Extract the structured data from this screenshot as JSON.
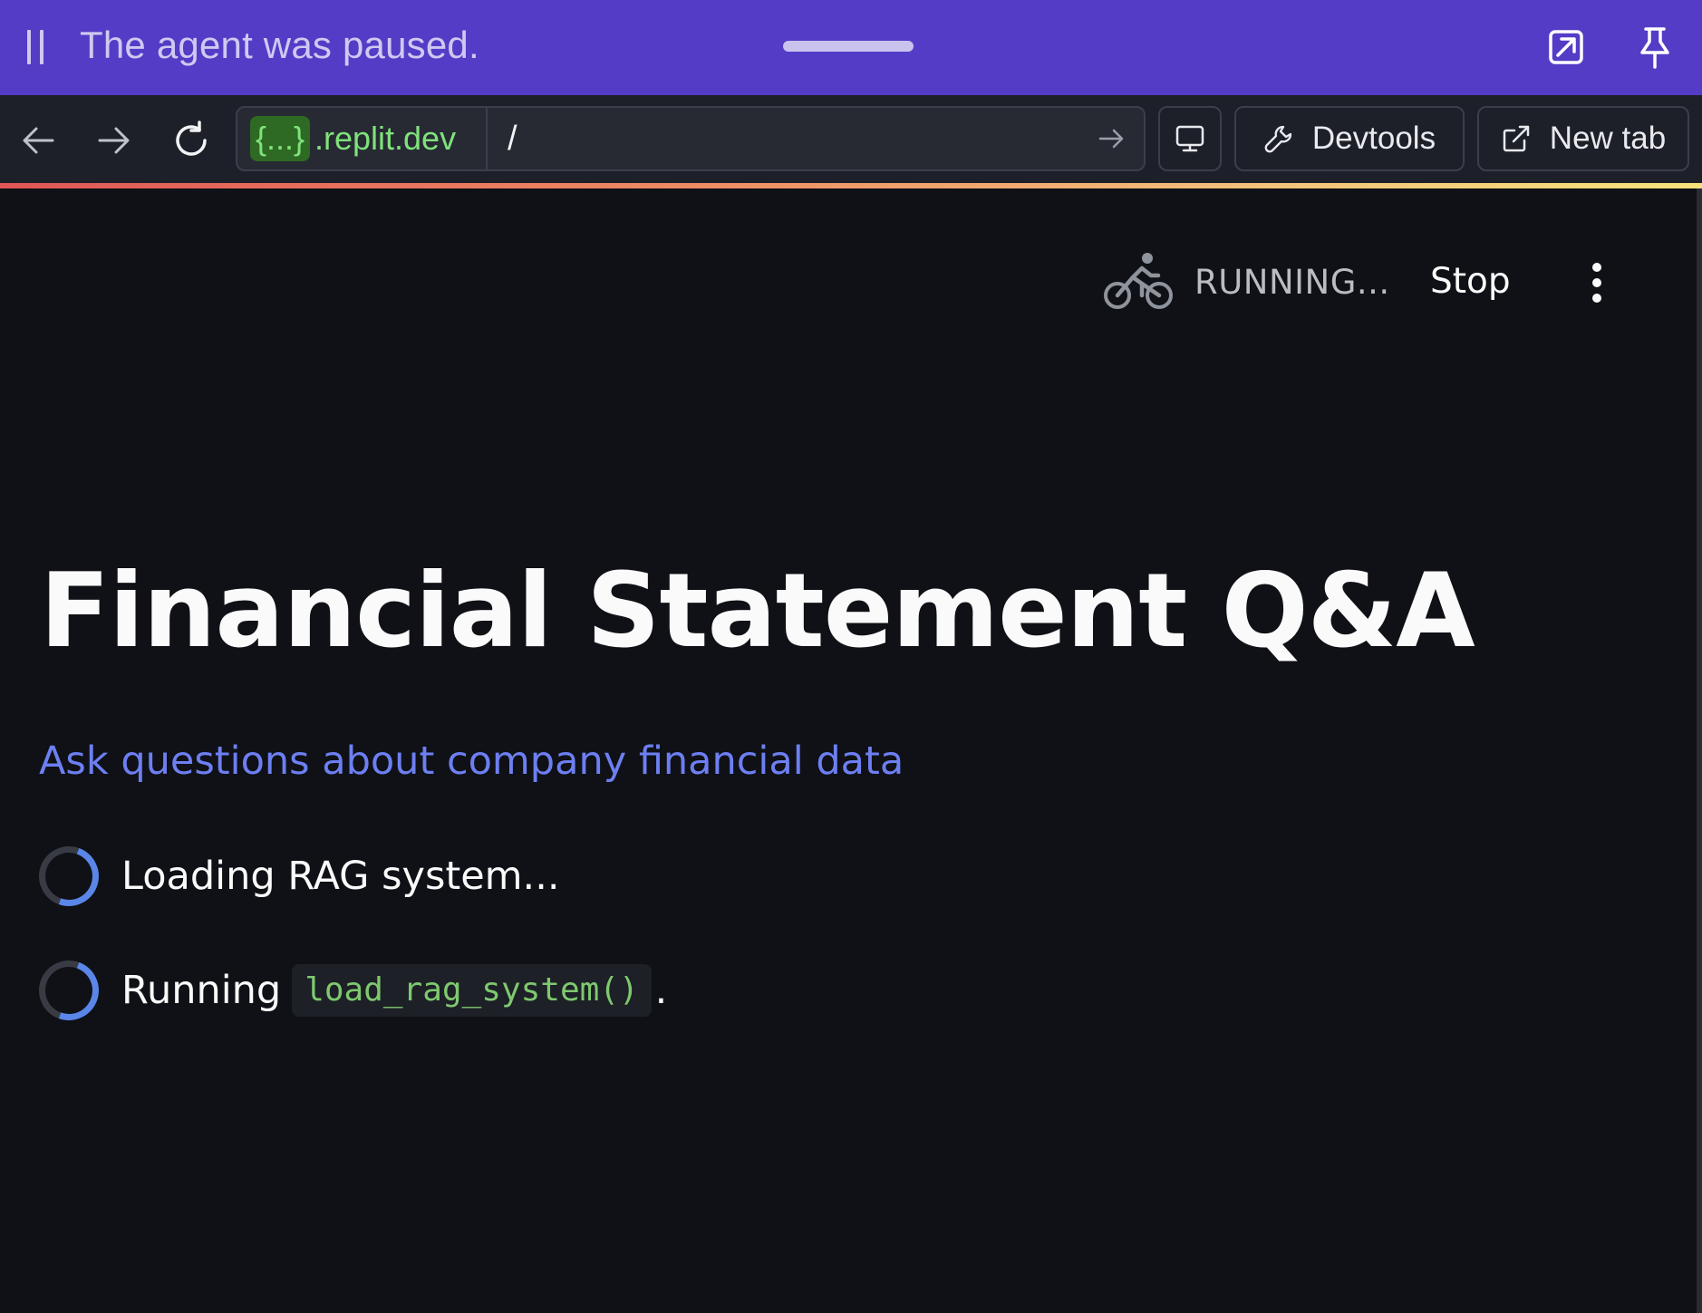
{
  "agent_banner": {
    "status_text": "The agent was paused.",
    "icons": [
      "pause-icon",
      "drag-handle",
      "open-external-icon",
      "pin-icon"
    ],
    "background": "#543cc6"
  },
  "browser": {
    "host_prefix": "{...}",
    "host_domain": ".replit.dev",
    "path": "/",
    "devtools_label": "Devtools",
    "new_tab_label": "New tab",
    "icons": [
      "back-arrow-icon",
      "forward-arrow-icon",
      "reload-icon",
      "go-arrow-icon",
      "monitor-icon",
      "wrench-icon",
      "external-link-icon"
    ]
  },
  "app": {
    "status_label": "RUNNING...",
    "stop_label": "Stop",
    "title": "Financial Statement Q&A",
    "subtitle": "Ask questions about company financial data",
    "loading_message": "Loading RAG system...",
    "running_prefix": "Running",
    "running_function": "load_rag_system()",
    "running_suffix": ".",
    "colors": {
      "background": "#0f1116",
      "subtitle": "#6d7ff2",
      "spinner_accent": "#5a86e8",
      "code": "#7fc86f"
    }
  }
}
